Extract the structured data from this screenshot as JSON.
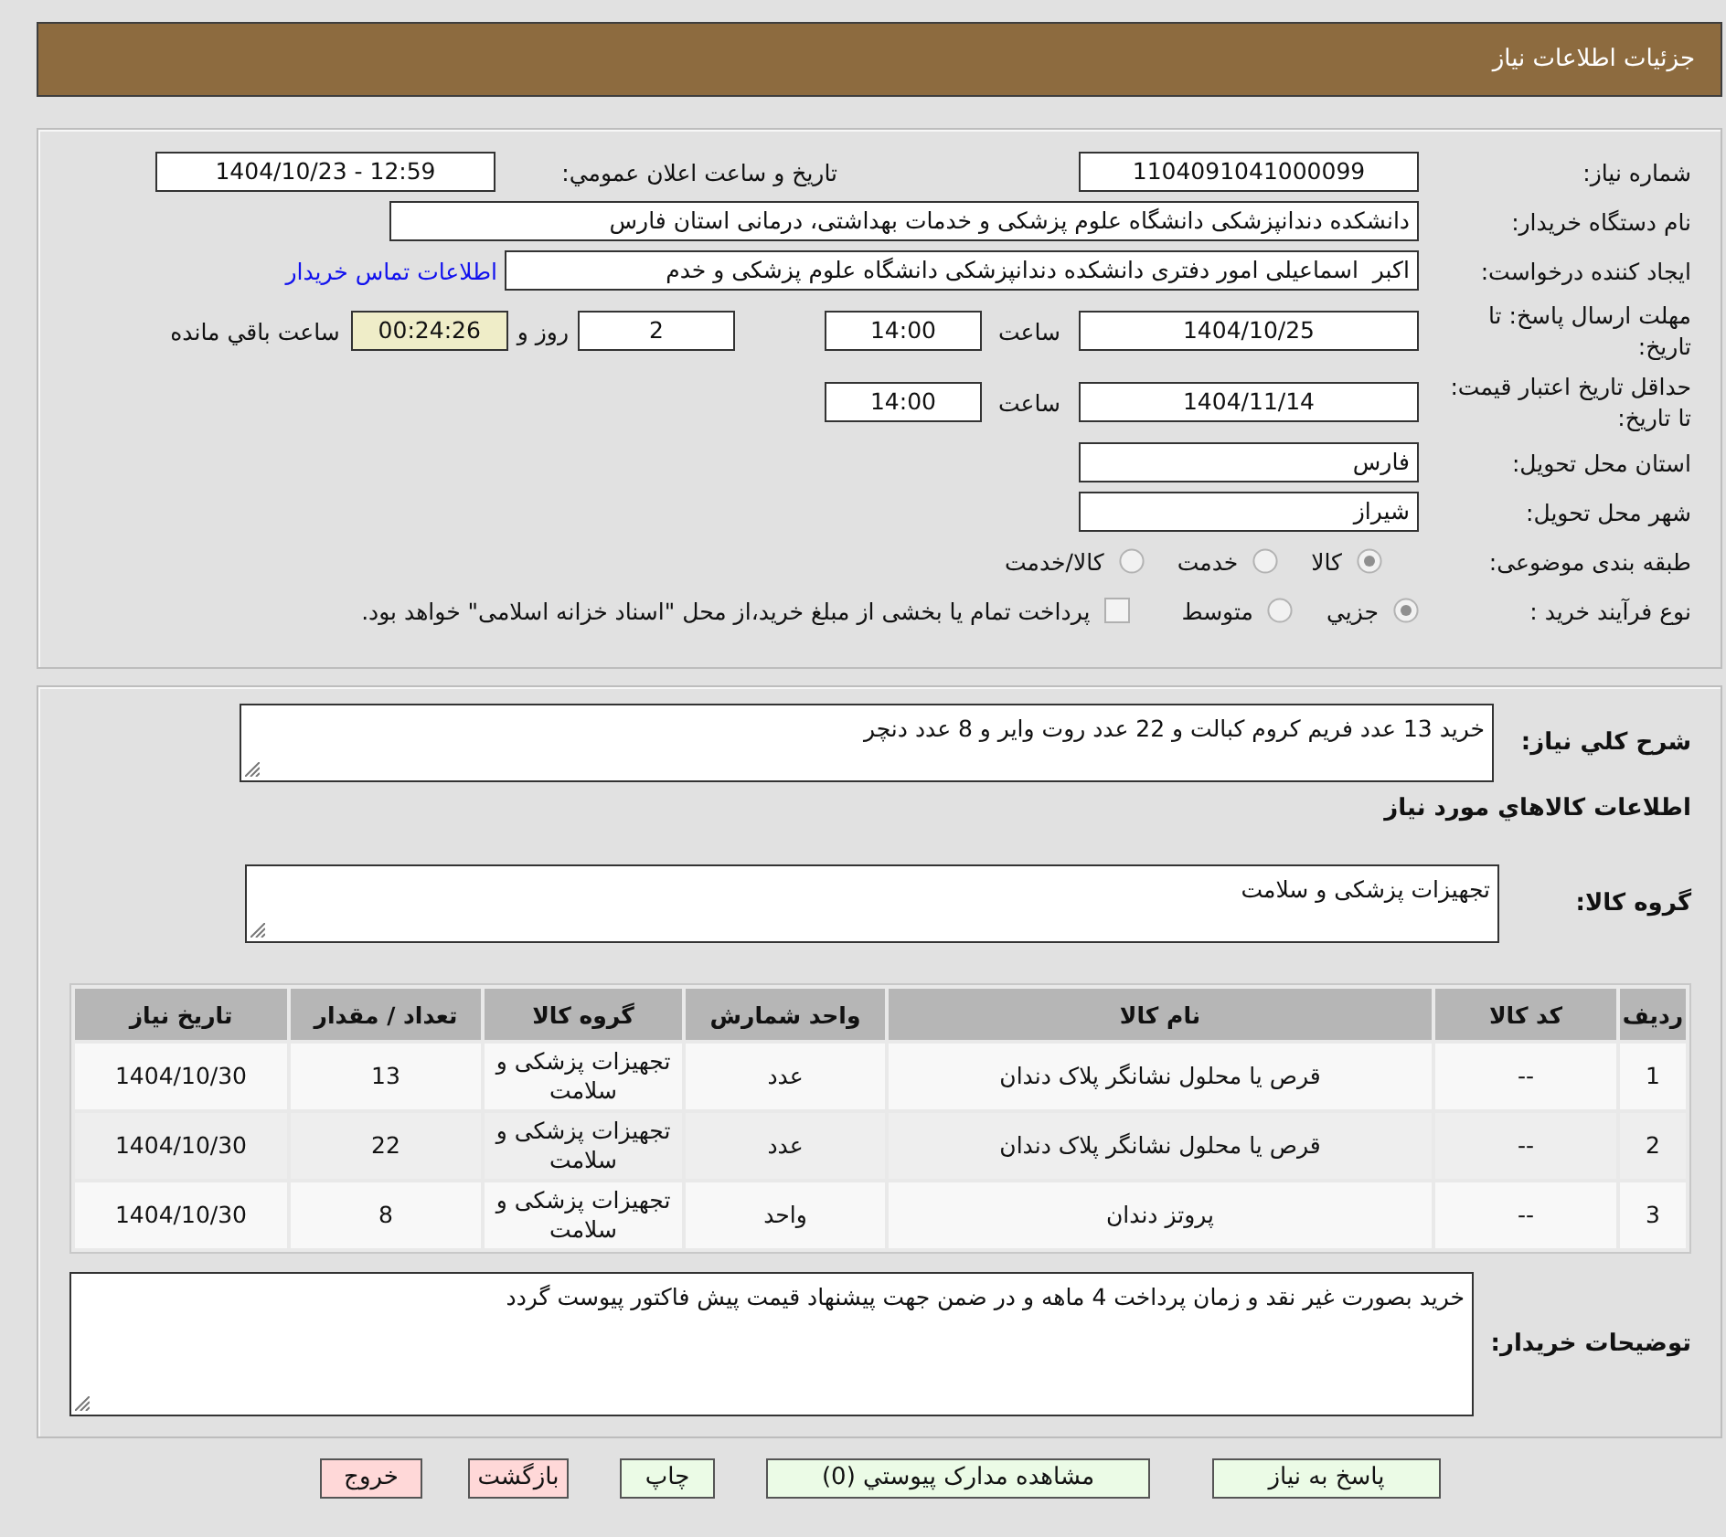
{
  "header": {
    "title": "جزئیات اطلاعات نیاز"
  },
  "details": {
    "need_number": {
      "label": "شماره نیاز:",
      "value": "1104091041000099"
    },
    "announce": {
      "label": "تاریخ و ساعت اعلان عمومي:",
      "value": "1404/10/23 - 12:59"
    },
    "buyer_org": {
      "label": "نام دستگاه خریدار:",
      "value": "دانشکده دندانپزشکی دانشگاه علوم پزشکی و خدمات بهداشتی، درمانی استان فارس"
    },
    "creator": {
      "label": "ایجاد کننده درخواست:",
      "value": "اکبر  اسماعیلی امور دفتری دانشکده دندانپزشکی دانشگاه علوم پزشکی و خدم",
      "link": "اطلاعات تماس خریدار"
    },
    "deadline": {
      "label": "مهلت ارسال پاسخ: تا تاریخ:",
      "date": "1404/10/25",
      "time_label": "ساعت",
      "time": "14:00",
      "days": "2",
      "days_label": "روز و",
      "remaining": "00:24:26",
      "remaining_label": "ساعت باقي مانده"
    },
    "validity": {
      "label": "حداقل تاریخ اعتبار قیمت: تا تاریخ:",
      "date": "1404/11/14",
      "time_label": "ساعت",
      "time": "14:00"
    },
    "province": {
      "label": "استان محل تحویل:",
      "value": "فارس"
    },
    "city": {
      "label": "شهر محل تحویل:",
      "value": "شیراز"
    },
    "category": {
      "label": "طبقه بندی موضوعی:",
      "options": [
        {
          "label": "کالا",
          "selected": true
        },
        {
          "label": "خدمت",
          "selected": false
        },
        {
          "label": "کالا/خدمت",
          "selected": false
        }
      ]
    },
    "process": {
      "label": "نوع فرآیند خرید :",
      "options": [
        {
          "label": "جزيي",
          "selected": true
        },
        {
          "label": "متوسط",
          "selected": false
        }
      ],
      "checkbox": {
        "checked": false,
        "label": "پرداخت تمام یا بخشی از مبلغ خرید،از محل \"اسناد خزانه اسلامی\" خواهد بود."
      }
    }
  },
  "description": {
    "label": "شرح کلي نیاز:",
    "value": "خرید 13 عدد فریم کروم کبالت و 22 عدد روت وایر و 8 عدد دنچر"
  },
  "items_title": "اطلاعات کالاهاي مورد نیاز",
  "goods_group": {
    "label": "گروه کالا:",
    "value": "تجهیزات پزشکی و سلامت"
  },
  "table": {
    "columns": [
      "ردیف",
      "کد کالا",
      "نام کالا",
      "واحد شمارش",
      "گروه کالا",
      "تعداد / مقدار",
      "تاریخ نیاز"
    ],
    "rows": [
      [
        "1",
        "--",
        "قرص یا محلول نشانگر پلاک دندان",
        "عدد",
        "تجهیزات پزشکی و سلامت",
        "13",
        "1404/10/30"
      ],
      [
        "2",
        "--",
        "قرص یا محلول نشانگر پلاک دندان",
        "عدد",
        "تجهیزات پزشکی و سلامت",
        "22",
        "1404/10/30"
      ],
      [
        "3",
        "--",
        "پروتز دندان",
        "واحد",
        "تجهیزات پزشکی و سلامت",
        "8",
        "1404/10/30"
      ]
    ]
  },
  "buyer_notes": {
    "label": "توضیحات خریدار:",
    "value": "خرید بصورت غیر نقد و زمان پرداخت 4 ماهه و در ضمن جهت پیشنهاد قیمت پیش فاکتور پیوست گردد"
  },
  "buttons": [
    {
      "label": "پاسخ به نیاز",
      "kind": "normal"
    },
    {
      "label": "مشاهده مدارک پیوستي (0)",
      "kind": "normal"
    },
    {
      "label": "چاپ",
      "kind": "normal"
    },
    {
      "label": "بازگشت",
      "kind": "danger"
    },
    {
      "label": "خروج",
      "kind": "danger"
    }
  ]
}
